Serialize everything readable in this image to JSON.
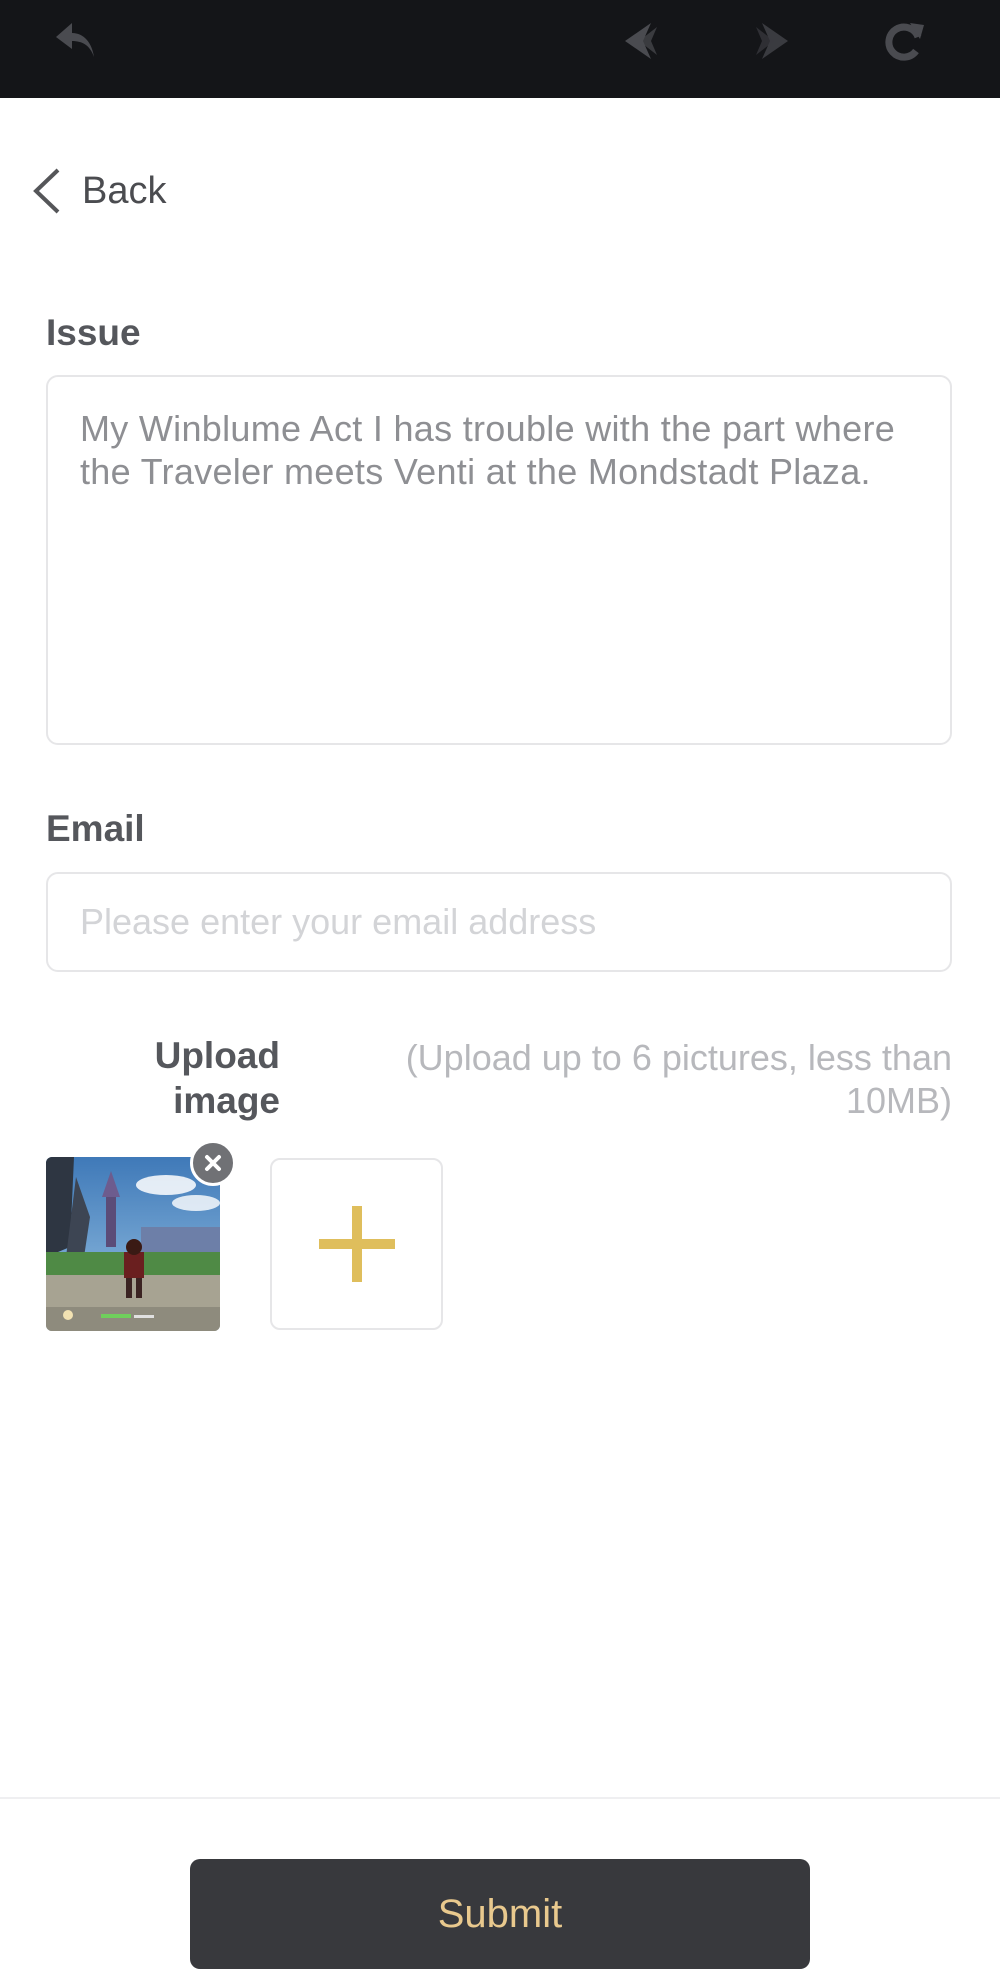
{
  "browser_toolbar": {
    "icons": [
      "undo-arrow-icon",
      "back-icon",
      "forward-icon",
      "reload-icon"
    ]
  },
  "nav": {
    "back_label": "Back"
  },
  "form": {
    "issue": {
      "label": "Issue",
      "value": "My Winblume Act I has trouble with the part where the Traveler meets Venti at the Mondstadt Plaza."
    },
    "email": {
      "label": "Email",
      "value": "",
      "placeholder": "Please enter your email address"
    },
    "upload": {
      "label": "Upload image",
      "hint": "(Upload up to 6 pictures, less than 10MB)",
      "images": [
        {
          "description": "game screenshot thumbnail"
        }
      ]
    },
    "submit_label": "Submit"
  },
  "colors": {
    "toolbar_bg": "#141518",
    "accent_gold": "#dfbe5c",
    "submit_bg": "#38393d",
    "submit_text": "#e9c98e"
  }
}
